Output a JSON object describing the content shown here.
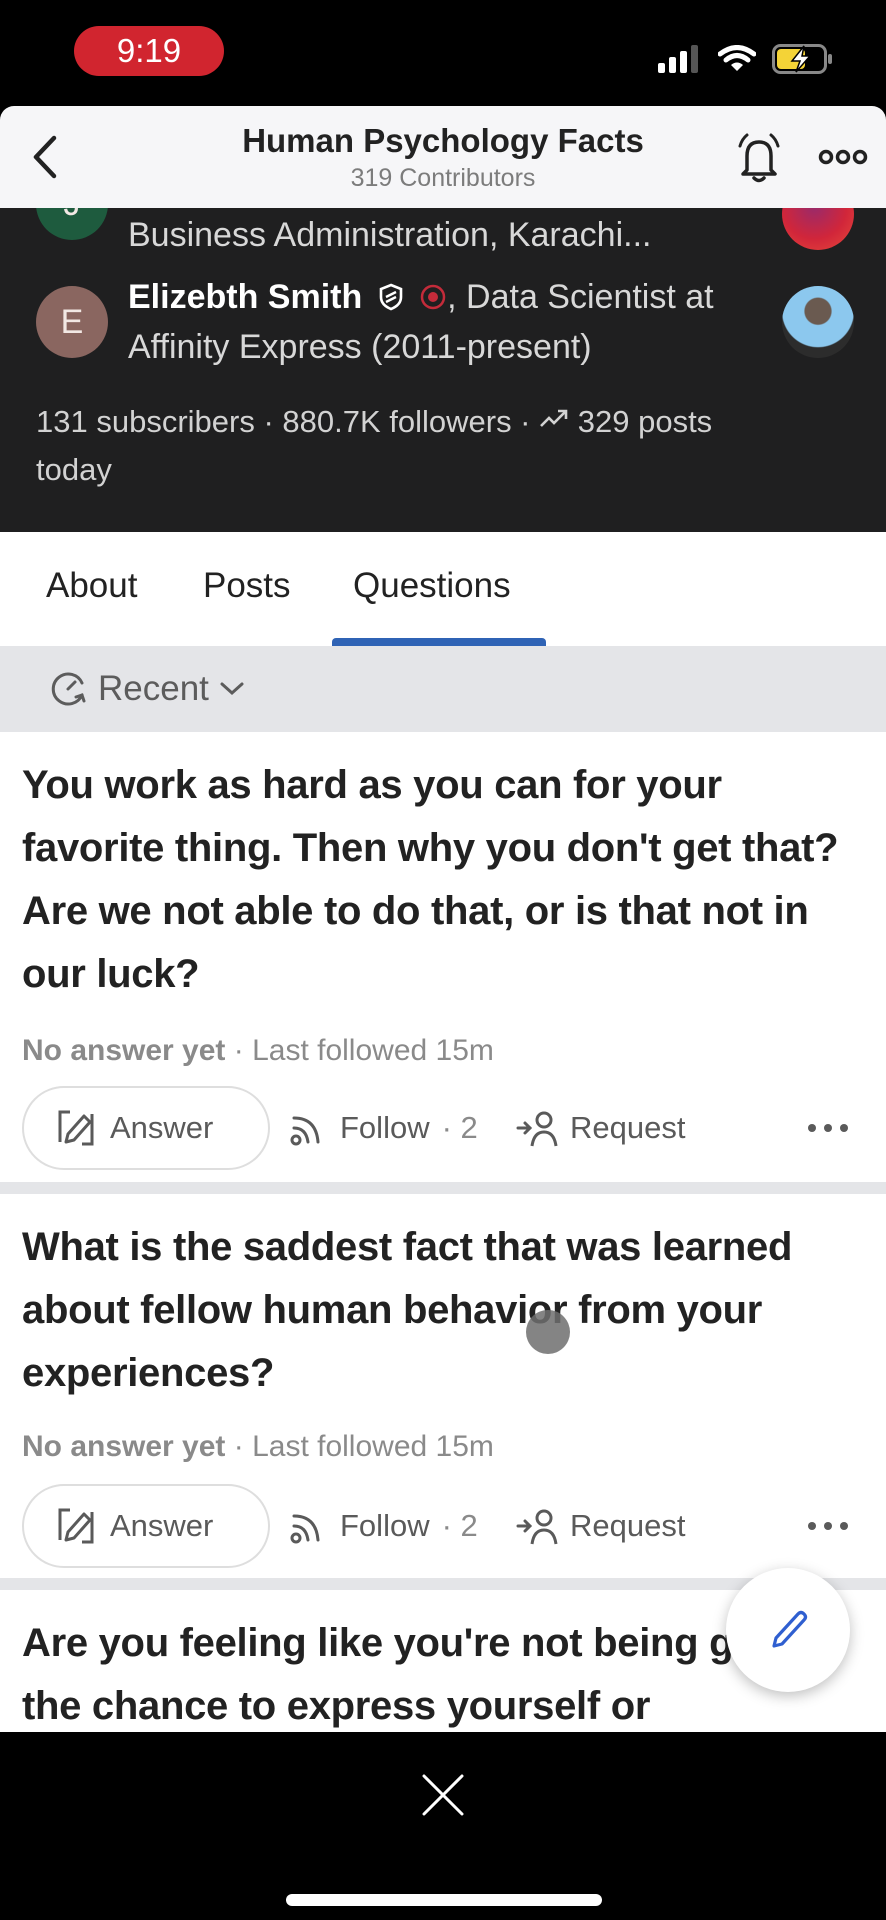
{
  "status_bar": {
    "time": "9:19",
    "icons": [
      "cellular-signal-icon",
      "wifi-icon",
      "battery-charging-icon"
    ],
    "time_pill_color": "#d1252f",
    "battery_color": "#f4d337"
  },
  "header": {
    "back_icon": "chevron-left-icon",
    "title": "Human Psychology Facts",
    "subtitle": "319 Contributors",
    "bell_icon": "bell-icon",
    "more_icon": "more-horizontal-icon"
  },
  "banner": {
    "contributors": [
      {
        "avatar_letter": "J",
        "line1_partial": "Business Administration, Karachi..."
      },
      {
        "avatar_letter": "E",
        "name": "Elizebth Smith",
        "badges": [
          "shield-icon",
          "asterisk-badge-icon"
        ],
        "credential_line1": ", Data Scientist at",
        "credential_line2": "Affinity Express (2011-present)"
      }
    ],
    "stats_line1": "131 subscribers · 880.7K followers · ",
    "stats_trend_icon": "trending-up-icon",
    "stats_posts": "329 posts",
    "stats_line2": "today"
  },
  "tabs": {
    "items": [
      {
        "label": "About",
        "active": false
      },
      {
        "label": "Posts",
        "active": false
      },
      {
        "label": "Questions",
        "active": true
      }
    ],
    "accent": "#2f63b5"
  },
  "sort": {
    "icon": "clock-refresh-icon",
    "label": "Recent",
    "chevron": "chevron-down-icon"
  },
  "questions": [
    {
      "title": "You work as hard as you can for your favorite thing. Then why you don't get that? Are we not able to do that, or is that not in our luck?",
      "status": "No answer yet",
      "meta": " · Last followed 15m",
      "answer_label": "Answer",
      "follow_label": "Follow",
      "follow_count": " · 2",
      "request_label": "Request"
    },
    {
      "title": "What is the saddest fact that was learned about fellow human behavior from your experiences?",
      "status": "No answer yet",
      "meta": " · Last followed 15m",
      "answer_label": "Answer",
      "follow_label": "Follow",
      "follow_count": " · 2",
      "request_label": "Request"
    },
    {
      "title": "Are you feeling like you're not being given the chance to express yourself or"
    }
  ],
  "fab": {
    "icon": "pencil-icon",
    "color": "#2f5fd0"
  },
  "bottom": {
    "close_icon": "close-icon"
  }
}
